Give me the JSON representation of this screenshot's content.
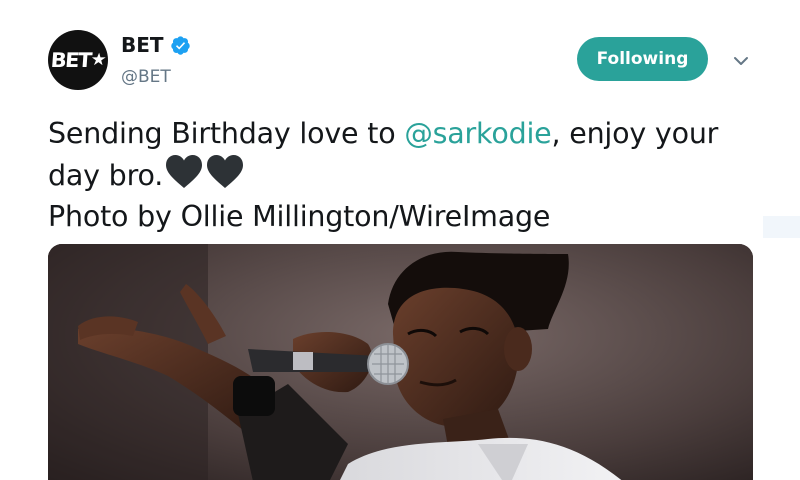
{
  "account": {
    "display_name": "BET",
    "handle": "@BET",
    "verified": true,
    "avatar_logo_text": "BET",
    "avatar_logo_mark": "★"
  },
  "follow_button": {
    "label": "Following",
    "color": "#2aa29a"
  },
  "menu": {
    "icon": "chevron-down-icon"
  },
  "tweet": {
    "text_before_mention": "Sending Birthday love to ",
    "mention": "@sarkodie",
    "text_after_mention": ", enjoy your day bro.",
    "emoji": [
      "black-heart-icon",
      "black-heart-icon"
    ],
    "credit": "Photo by Ollie Millington/WireImage"
  },
  "media": {
    "type": "photo",
    "subject": "performer-singing-into-microphone"
  },
  "colors": {
    "accent": "#2aa29a",
    "text": "#14171a",
    "secondary_text": "#657786",
    "verified": "#1da1f2"
  }
}
